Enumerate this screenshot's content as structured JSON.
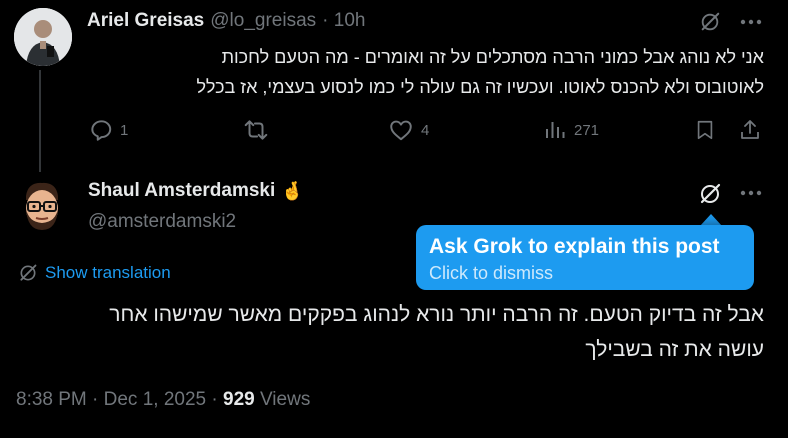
{
  "parent_post": {
    "author_name": "Ariel Greisas",
    "handle": "@lo_greisas",
    "time": "· 10h",
    "text_line1": "אני לא נוהג אבל כמוני הרבה מסתכלים על זה ואומרים - מה הטעם לחכות",
    "text_line2": "לאוטובוס ולא להכנס לאוטו. ועכשיו זה גם עולה לי כמו לנסוע בעצמי, אז בכלל",
    "reply_count": "1",
    "repost_count": "",
    "like_count": "4",
    "view_count": "271"
  },
  "main_post": {
    "author_name": "Shaul Amsterdamski",
    "author_emoji": "🤞",
    "handle": "@amsterdamski2",
    "show_translation": "Show translation",
    "text_line1": "אבל זה בדיוק הטעם. זה הרבה יותר נורא לנהוג בפקקים מאשר שמישהו אחר",
    "text_line2": "עושה את זה בשבילך",
    "timestamp": "8:38 PM · Dec 1, 2025 · ",
    "views_count": "929",
    "views_label": " Views"
  },
  "grok_tooltip": {
    "title": "Ask Grok to explain this post",
    "subtitle": "Click to dismiss"
  },
  "colors": {
    "background": "#000000",
    "text": "#e7e9ea",
    "muted": "#71767b",
    "accent": "#1d9bf0"
  }
}
